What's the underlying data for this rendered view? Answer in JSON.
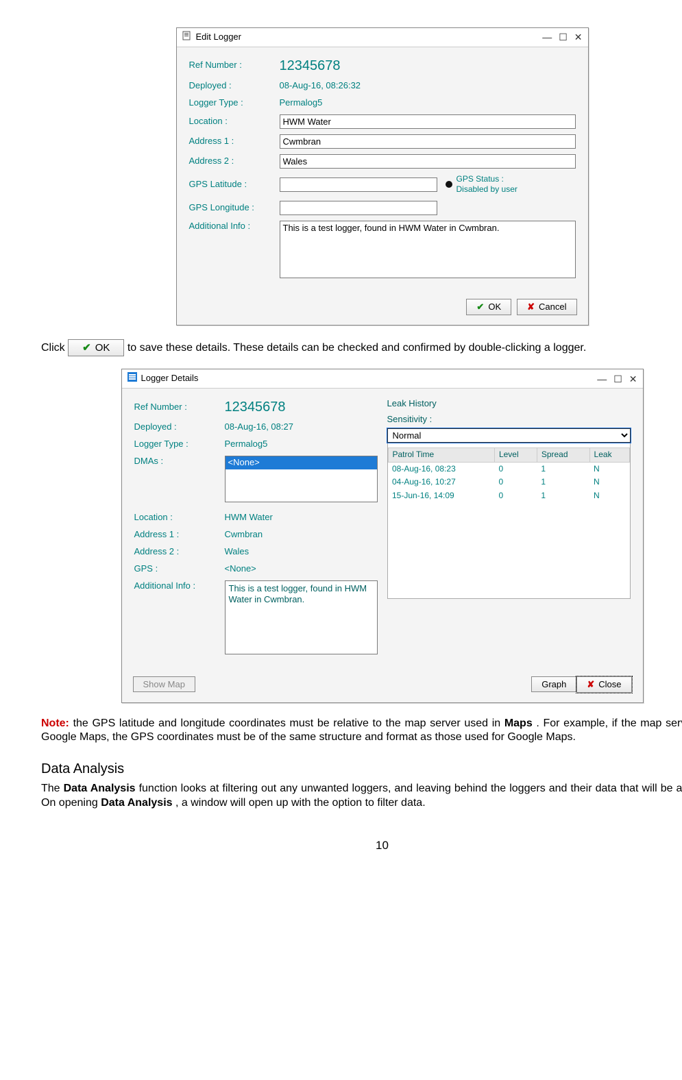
{
  "edit_logger_window": {
    "title": "Edit Logger",
    "ref_number_label": "Ref Number :",
    "ref_number_value": "12345678",
    "deployed_label": "Deployed :",
    "deployed_value": "08-Aug-16, 08:26:32",
    "logger_type_label": "Logger Type :",
    "logger_type_value": "Permalog5",
    "location_label": "Location :",
    "location_value": "HWM Water",
    "address1_label": "Address 1 :",
    "address1_value": "Cwmbran",
    "address2_label": "Address 2 :",
    "address2_value": "Wales",
    "gps_latitude_label": "GPS Latitude :",
    "gps_latitude_value": "",
    "gps_longitude_label": "GPS Longitude :",
    "gps_longitude_value": "",
    "gps_status_label": "GPS Status :",
    "gps_status_value": "Disabled by user",
    "additional_info_label": "Additional Info :",
    "additional_info_value": "This is a test logger, found in HWM Water in Cwmbran.",
    "ok_label": "OK",
    "cancel_label": "Cancel"
  },
  "inline_ok_button_label": "OK",
  "body_text": {
    "click_sentence_1": "Click ",
    "click_sentence_2": " to save these details. These details can be checked and confirmed by double-clicking a logger.",
    "note_heading": "Note:",
    "note_body": " the GPS latitude and longitude coordinates must be relative to the map server used in ",
    "note_body_2": ". For example, if the map server uses Google Maps, the GPS coordinates must be of the same structure and format as those used for Google Maps.",
    "maps_bold": "Maps",
    "analysis_heading": "Data Analysis",
    "analysis_body_1": "The ",
    "analysis_bold_1": "Data Analysis",
    "analysis_body_2": " function looks at filtering out any unwanted loggers, and leaving behind the loggers and their data that will be analysed. On opening ",
    "analysis_bold_2": "Data Analysis",
    "analysis_body_3": ", a window will open up with the option to filter data.",
    "page_number": "10"
  },
  "logger_details_window": {
    "title": "Logger Details",
    "ref_number_label": "Ref Number :",
    "ref_number_value": "12345678",
    "deployed_label": "Deployed :",
    "deployed_value": "08-Aug-16, 08:27",
    "logger_type_label": "Logger Type :",
    "logger_type_value": "Permalog5",
    "dmas_label": "DMAs :",
    "dmas_selected": "<None>",
    "location_label": "Location :",
    "location_value": "HWM Water",
    "address1_label": "Address 1 :",
    "address1_value": "Cwmbran",
    "address2_label": "Address 2 :",
    "address2_value": "Wales",
    "gps_label": "GPS :",
    "gps_value": "<None>",
    "additional_info_label": "Additional Info :",
    "additional_info_value": "This is a test logger, found in HWM Water in Cwmbran.",
    "leak_history_heading": "Leak History",
    "sensitivity_label": "Sensitivity :",
    "sensitivity_value": "Normal",
    "col_patrol_time": "Patrol Time",
    "col_level": "Level",
    "col_spread": "Spread",
    "col_leak": "Leak",
    "rows": [
      {
        "time": "08-Aug-16, 08:23",
        "level": "0",
        "spread": "1",
        "leak": "N"
      },
      {
        "time": "04-Aug-16, 10:27",
        "level": "0",
        "spread": "1",
        "leak": "N"
      },
      {
        "time": "15-Jun-16, 14:09",
        "level": "0",
        "spread": "1",
        "leak": "N"
      }
    ],
    "show_map_label": "Show Map",
    "graph_label": "Graph",
    "close_label": "Close"
  }
}
